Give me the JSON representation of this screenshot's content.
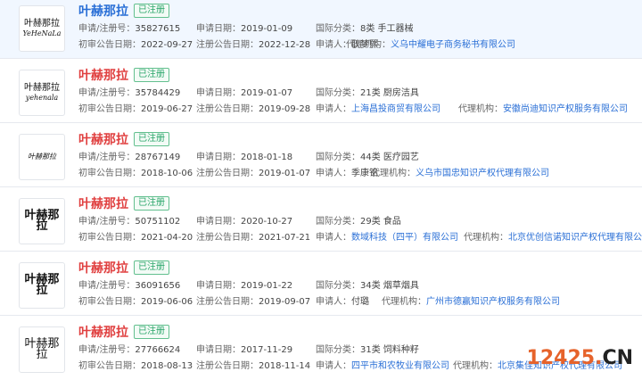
{
  "labels": {
    "reg_no": "申请/注册号：",
    "apply_date": "申请日期：",
    "intl_class": "国际分类：",
    "first_pub": "初审公告日期：",
    "reg_pub": "注册公告日期：",
    "applicant": "申请人：",
    "agent": "代理机构："
  },
  "items": [
    {
      "logo_line1": "叶赫那拉",
      "logo_line2": "YeHeNaLa",
      "name": "叶赫那拉",
      "status": "已注册",
      "reg_no": "35827615",
      "apply_date": "2019-01-09",
      "intl_class": "8类 手工器械",
      "first_pub": "2022-09-27",
      "reg_pub": "2022-12-28",
      "applicant": "耿梦熙",
      "agent": "义乌中耀电子商务秘书有限公司"
    },
    {
      "logo_line1": "叶赫那拉",
      "logo_line2": "yehenala",
      "name": "叶赫那拉",
      "status": "已注册",
      "reg_no": "35784429",
      "apply_date": "2019-01-07",
      "intl_class": "21类 厨房洁具",
      "first_pub": "2019-06-27",
      "reg_pub": "2019-09-28",
      "applicant": "上海昌投商贸有限公司",
      "agent": "安徽尚迪知识产权服务有限公司"
    },
    {
      "logo_line1": "叶赫那拉",
      "logo_line2": "",
      "name": "叶赫那拉",
      "status": "已注册",
      "reg_no": "28767149",
      "apply_date": "2018-01-18",
      "intl_class": "44类 医疗园艺",
      "first_pub": "2018-10-06",
      "reg_pub": "2019-01-07",
      "applicant": "季康铭",
      "agent": "义乌市国忠知识产权代理有限公司"
    },
    {
      "logo_line1": "叶赫那拉",
      "logo_line2": "",
      "name": "叶赫那拉",
      "status": "已注册",
      "reg_no": "50751102",
      "apply_date": "2020-10-27",
      "intl_class": "29类 食品",
      "first_pub": "2021-04-20",
      "reg_pub": "2021-07-21",
      "applicant": "数域科技（四平）有限公司",
      "agent": "北京优创信诺知识产权代理有限公司"
    },
    {
      "logo_line1": "叶赫那拉",
      "logo_line2": "",
      "name": "叶赫那拉",
      "status": "已注册",
      "reg_no": "36091656",
      "apply_date": "2019-01-22",
      "intl_class": "34类 烟草烟具",
      "first_pub": "2019-06-06",
      "reg_pub": "2019-09-07",
      "applicant": "付璐",
      "agent": "广州市德赢知识产权服务有限公司"
    },
    {
      "logo_line1": "叶赫那拉",
      "logo_line2": "",
      "name": "叶赫那拉",
      "status": "已注册",
      "reg_no": "27766624",
      "apply_date": "2017-11-29",
      "intl_class": "31类 饲料种籽",
      "first_pub": "2018-08-13",
      "reg_pub": "2018-11-14",
      "applicant": "四平市和农牧业有限公司",
      "agent": "北京集佳知识产权代理有限公司"
    }
  ],
  "watermark": {
    "number": "12425",
    "dot": ".",
    "suffix": "CN"
  }
}
